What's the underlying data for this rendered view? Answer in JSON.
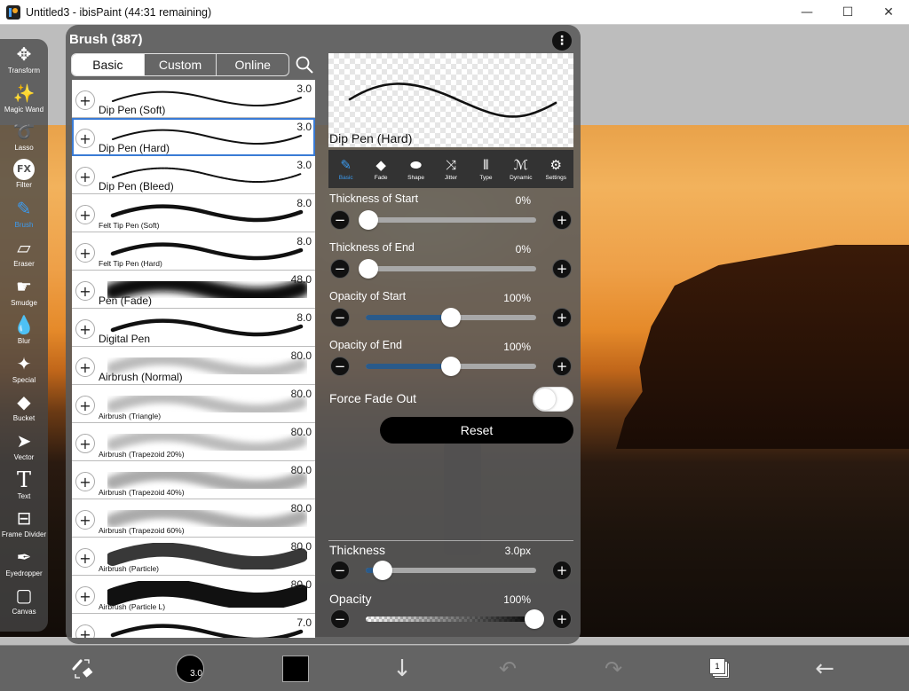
{
  "window": {
    "title": "Untitled3 - ibisPaint (44:31 remaining)",
    "controls": {
      "minimize": "—",
      "maximize": "☐",
      "close": "✕"
    }
  },
  "toolbar": {
    "items": [
      {
        "label": "Transform",
        "icon": "move-arrows-icon",
        "glyph": "✥"
      },
      {
        "label": "Magic Wand",
        "icon": "magic-wand-icon",
        "glyph": "✨"
      },
      {
        "label": "Lasso",
        "icon": "lasso-icon",
        "glyph": "➰"
      },
      {
        "label": "Filter",
        "icon": "fx-icon",
        "glyph": "FX"
      },
      {
        "label": "Brush",
        "icon": "brush-icon",
        "glyph": "✎",
        "active": true
      },
      {
        "label": "Eraser",
        "icon": "eraser-icon",
        "glyph": "▱"
      },
      {
        "label": "Smudge",
        "icon": "smudge-icon",
        "glyph": "☛"
      },
      {
        "label": "Blur",
        "icon": "droplet-icon",
        "glyph": "💧"
      },
      {
        "label": "Special",
        "icon": "special-pen-icon",
        "glyph": "✦"
      },
      {
        "label": "Bucket",
        "icon": "bucket-icon",
        "glyph": "◆"
      },
      {
        "label": "Vector",
        "icon": "cursor-arrow-icon",
        "glyph": "➤"
      },
      {
        "label": "Text",
        "icon": "text-icon",
        "glyph": "T"
      },
      {
        "label": "Frame Divider",
        "icon": "frame-divider-icon",
        "glyph": "⊟"
      },
      {
        "label": "Eyedropper",
        "icon": "eyedropper-icon",
        "glyph": "✒"
      },
      {
        "label": "Canvas",
        "icon": "canvas-icon",
        "glyph": "▢"
      }
    ]
  },
  "brush_panel": {
    "title": "Brush (387)",
    "menu_glyph": "⋮",
    "tabs": [
      {
        "label": "Basic",
        "active": true
      },
      {
        "label": "Custom",
        "active": false
      },
      {
        "label": "Online",
        "active": false
      }
    ],
    "brushes": [
      {
        "name": "Dip Pen (Soft)",
        "size": "3.0",
        "small": false,
        "style": "thin"
      },
      {
        "name": "Dip Pen (Hard)",
        "size": "3.0",
        "small": false,
        "style": "thin",
        "selected": true
      },
      {
        "name": "Dip Pen (Bleed)",
        "size": "3.0",
        "small": false,
        "style": "bleed"
      },
      {
        "name": "Felt Tip Pen (Soft)",
        "size": "8.0",
        "small": true,
        "style": "medium"
      },
      {
        "name": "Felt Tip Pen (Hard)",
        "size": "8.0",
        "small": true,
        "style": "medium"
      },
      {
        "name": "Pen (Fade)",
        "size": "48.0",
        "small": false,
        "style": "fade"
      },
      {
        "name": "Digital Pen",
        "size": "8.0",
        "small": false,
        "style": "medium"
      },
      {
        "name": "Airbrush (Normal)",
        "size": "80.0",
        "small": false,
        "style": "air-light"
      },
      {
        "name": "Airbrush (Triangle)",
        "size": "80.0",
        "small": true,
        "style": "air-light"
      },
      {
        "name": "Airbrush (Trapezoid 20%)",
        "size": "80.0",
        "small": true,
        "style": "air-light"
      },
      {
        "name": "Airbrush (Trapezoid 40%)",
        "size": "80.0",
        "small": true,
        "style": "air-mid"
      },
      {
        "name": "Airbrush (Trapezoid 60%)",
        "size": "80.0",
        "small": true,
        "style": "air-mid"
      },
      {
        "name": "Airbrush (Particle)",
        "size": "80.0",
        "small": true,
        "style": "particle"
      },
      {
        "name": "Airbrush (Particle L)",
        "size": "80.0",
        "small": true,
        "style": "particle-l"
      },
      {
        "name": "",
        "size": "7.0",
        "small": true,
        "style": "medium"
      }
    ],
    "preview_name": "Dip Pen (Hard)",
    "property_tabs": [
      {
        "label": "Basic",
        "icon": "brush-icon",
        "glyph": "✎",
        "active": true
      },
      {
        "label": "Fade",
        "icon": "fade-diamond-icon",
        "glyph": "◆"
      },
      {
        "label": "Shape",
        "icon": "shape-ellipse-icon",
        "glyph": "⬬"
      },
      {
        "label": "Jitter",
        "icon": "shuffle-icon",
        "glyph": "⤨"
      },
      {
        "label": "Type",
        "icon": "type-icon",
        "glyph": "⫴"
      },
      {
        "label": "Dynamic",
        "icon": "dynamic-icon",
        "glyph": "ℳ"
      },
      {
        "label": "Settings",
        "icon": "gear-icon",
        "glyph": "⚙"
      }
    ],
    "sliders": [
      {
        "label": "Thickness of Start",
        "value": "0%",
        "fraction": 0.0,
        "filled": false
      },
      {
        "label": "Thickness of End",
        "value": "0%",
        "fraction": 0.0,
        "filled": false
      },
      {
        "label": "Opacity of Start",
        "value": "100%",
        "fraction": 0.5,
        "filled": true
      },
      {
        "label": "Opacity of End",
        "value": "100%",
        "fraction": 0.5,
        "filled": true
      }
    ],
    "force_fade_out": {
      "label": "Force Fade Out",
      "on": false
    },
    "reset_label": "Reset",
    "thickness": {
      "label": "Thickness",
      "value": "3.0px",
      "fraction": 0.1
    },
    "opacity": {
      "label": "Opacity",
      "value": "100%",
      "fraction": 1.0
    },
    "minus_glyph": "−",
    "plus_glyph": "+"
  },
  "bottom_bar": {
    "brush_size": "3.0",
    "layer_count": "1",
    "undo_glyph": "↶",
    "redo_glyph": "↷",
    "down_glyph": "↓",
    "back_glyph": "←"
  },
  "colors": {
    "accent": "#3b9bf0",
    "slider_fill": "#2a5a8a",
    "selected_outline": "#3a7bd5",
    "current_color": "#000000"
  }
}
